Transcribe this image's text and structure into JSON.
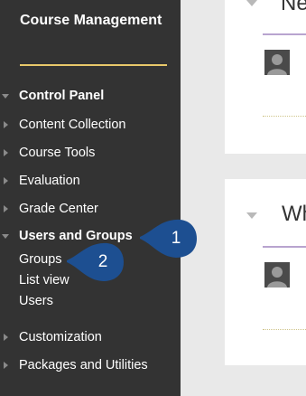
{
  "sidebar": {
    "title": "Course Management",
    "items": [
      {
        "label": "Control Panel"
      },
      {
        "label": "Content Collection"
      },
      {
        "label": "Course Tools"
      },
      {
        "label": "Evaluation"
      },
      {
        "label": "Grade Center"
      },
      {
        "label": "Users and Groups"
      },
      {
        "label": "Customization"
      },
      {
        "label": "Packages and Utilities"
      }
    ],
    "subitems": [
      {
        "label": "Groups"
      },
      {
        "label": "List view"
      },
      {
        "label": "Users"
      }
    ]
  },
  "callouts": [
    {
      "number": "1"
    },
    {
      "number": "2"
    }
  ],
  "main": {
    "panels": [
      {
        "title": "Ne"
      },
      {
        "title": "Wh"
      }
    ]
  },
  "colors": {
    "sidebar_bg": "#333333",
    "accent_line": "#e8c86a",
    "callout_blue": "#1d4f91",
    "panel_underline": "#b8a4cf"
  }
}
